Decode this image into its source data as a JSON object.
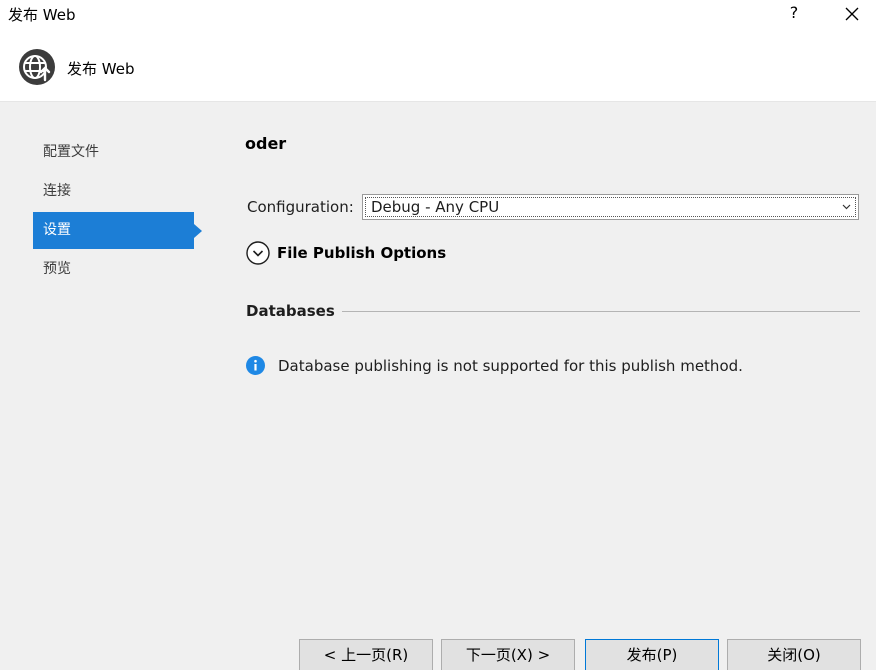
{
  "window": {
    "title": "发布 Web",
    "help_label": "?"
  },
  "header": {
    "title": "发布 Web"
  },
  "sidebar": {
    "items": [
      {
        "label": "配置文件",
        "active": false
      },
      {
        "label": "连接",
        "active": false
      },
      {
        "label": "设置",
        "active": true
      },
      {
        "label": "预览",
        "active": false
      }
    ]
  },
  "main": {
    "profile_name": "oder",
    "configuration": {
      "label": "Configuration:",
      "value": "Debug - Any CPU"
    },
    "file_publish_options": {
      "label": "File Publish Options",
      "expanded": false
    },
    "databases": {
      "title": "Databases",
      "info_message": "Database publishing is not supported for this publish method."
    }
  },
  "buttons": {
    "previous": "< 上一页(R)",
    "next": "下一页(X) >",
    "publish": "发布(P)",
    "close": "关闭(O)"
  },
  "colors": {
    "accent": "#1c7ed6",
    "info_icon": "#1e88e5",
    "background": "#f0f0f0"
  }
}
